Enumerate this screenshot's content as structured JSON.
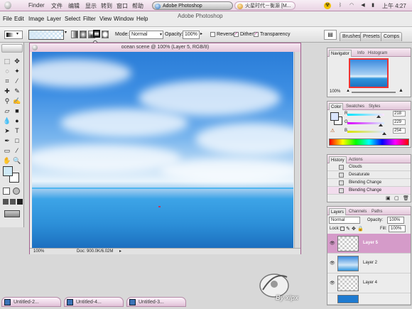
{
  "menubar": {
    "finder": "Finder",
    "items": [
      "文件",
      "编辑",
      "显示",
      "转到",
      "窗口",
      "帮助"
    ],
    "active_app": "Adobe Photoshop",
    "second_app": "火星时代－衡源 [M...",
    "clock": "上午 4:27"
  },
  "ps_menu": {
    "items": [
      "File",
      "Edit",
      "Image",
      "Layer",
      "Select",
      "Filter",
      "View",
      "Window",
      "Help"
    ],
    "title": "Adobe Photoshop"
  },
  "options": {
    "mode_label": "Mode:",
    "mode_value": "Normal",
    "opacity_label": "Opacity:",
    "opacity_value": "100%",
    "reverse_label": "Reverse",
    "dither_label": "Dither",
    "transparency_label": "Transparency",
    "reverse_checked": false,
    "dither_checked": true,
    "transparency_checked": true,
    "tabs": [
      "Brushes",
      "Presets",
      "Comps"
    ]
  },
  "document": {
    "title": "ocean scene @ 100% (Layer 5, RGB/8)",
    "zoom": "100%",
    "doc_info": "Doc: 900.0K/6.02M"
  },
  "navigator": {
    "tabs": [
      "Navigator",
      "Info",
      "Histogram"
    ],
    "zoom": "100%"
  },
  "color": {
    "tabs": [
      "Color",
      "Swatches",
      "Styles"
    ],
    "r_label": "R",
    "g_label": "G",
    "b_label": "B",
    "r": 218,
    "g": 229,
    "b": 254,
    "foreground": "#dae5fe"
  },
  "history": {
    "tabs": [
      "History",
      "Actions"
    ],
    "items": [
      "Clouds",
      "Desaturate",
      "Blending Change",
      "Blending Change"
    ]
  },
  "layers": {
    "tabs": [
      "Layers",
      "Channels",
      "Paths"
    ],
    "blend_mode": "Normal",
    "opacity_label": "Opacity:",
    "opacity_value": "100%",
    "lock_label": "Lock:",
    "fill_label": "Fill:",
    "fill_value": "100%",
    "items": [
      "Layer 5",
      "Layer 2",
      "Layer 4"
    ]
  },
  "dock": {
    "items": [
      "Untitled-2...",
      "Untitled-4...",
      "Untitled-3..."
    ]
  },
  "watermark": "By xipx"
}
